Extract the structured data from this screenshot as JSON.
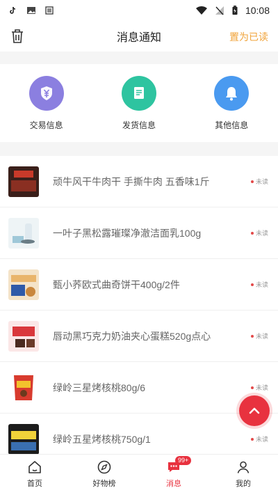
{
  "status_bar": {
    "time": "10:08"
  },
  "header": {
    "title": "消息通知",
    "mark_read": "置为已读"
  },
  "categories": [
    {
      "label": "交易信息",
      "icon": "yuan-icon",
      "color": "#8b7fe0"
    },
    {
      "label": "发货信息",
      "icon": "document-icon",
      "color": "#2ec4a0"
    },
    {
      "label": "其他信息",
      "icon": "bell-icon",
      "color": "#4a9af0"
    }
  ],
  "messages": [
    {
      "title": "顽牛风干牛肉干 手撕牛肉 五香味1斤",
      "status": "未读"
    },
    {
      "title": "一叶子黑松露璀璨净澈洁面乳100g",
      "status": "未读"
    },
    {
      "title": "甄小荞欧式曲奇饼干400g/2件",
      "status": "未读"
    },
    {
      "title": "唇动黑巧克力奶油夹心蛋糕520g点心",
      "status": "未读"
    },
    {
      "title": "绿岭三星烤核桃80g/6",
      "status": "未读"
    },
    {
      "title": "绿岭五星烤核桃750g/1",
      "status": "未读"
    }
  ],
  "bottom_nav": {
    "home": "首页",
    "goods": "好物榜",
    "messages": "消息",
    "messages_badge": "99+",
    "mine": "我的"
  },
  "colors": {
    "accent": "#e8323f",
    "mark_read": "#f0a33a"
  }
}
